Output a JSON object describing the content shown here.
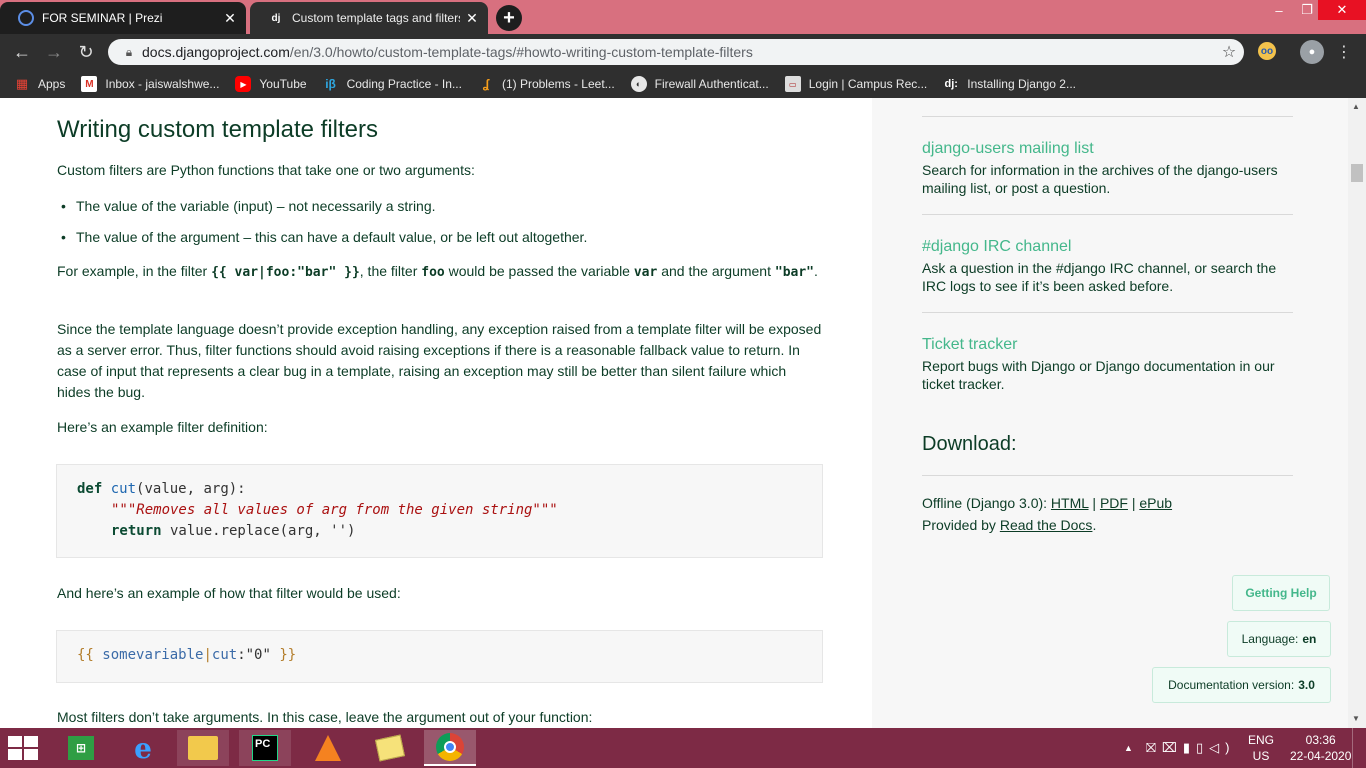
{
  "browser": {
    "tabs": [
      {
        "title": "FOR SEMINAR | Prezi",
        "favicon": "prezi-icon"
      },
      {
        "title": "Custom template tags and filters",
        "favicon": "django-icon"
      }
    ],
    "new_tab_label": "+",
    "address": {
      "host": "docs.djangoproject.com",
      "path": "/en/3.0/howto/custom-template-tags/#howto-writing-custom-template-filters"
    },
    "bookmarks": [
      {
        "label": "Apps",
        "icon": "apps-icon"
      },
      {
        "label": "Inbox - jaiswalshwe...",
        "icon": "gmail-icon"
      },
      {
        "label": "YouTube",
        "icon": "youtube-icon"
      },
      {
        "label": "Coding Practice - In...",
        "icon": "interviewbit-icon"
      },
      {
        "label": "(1) Problems - Leet...",
        "icon": "leetcode-icon"
      },
      {
        "label": "Firewall Authenticat...",
        "icon": "globe-icon"
      },
      {
        "label": "Login | Campus Rec...",
        "icon": "login-icon"
      },
      {
        "label": "Installing Django 2...",
        "icon": "django-icon"
      }
    ]
  },
  "article": {
    "heading": "Writing custom template filters",
    "intro": "Custom filters are Python functions that take one or two arguments:",
    "bullets": [
      "The value of the variable (input) – not necessarily a string.",
      "The value of the argument – this can have a default value, or be left out altogether."
    ],
    "example_parts": {
      "t1": "For example, in the filter ",
      "c1": "{{ var|foo:\"bar\" }}",
      "t2": ", the filter ",
      "c2": "foo",
      "t3": " would be passed the variable ",
      "c3": "var",
      "t4": " and the argument ",
      "c4": "\"bar\"",
      "t5": "."
    },
    "exceptions_para": "Since the template language doesn’t provide exception handling, any exception raised from a template filter will be exposed as a server error. Thus, filter functions should avoid raising exceptions if there is a reasonable fallback value to return. In case of input that represents a clear bug in a template, raising an exception may still be better than silent failure which hides the bug.",
    "example_def_label": "Here’s an example filter definition:",
    "code1": {
      "kw_def": "def",
      "fn_name": "cut",
      "signature": "(value, arg):",
      "docstring": "\"\"\"Removes all values of arg from the given string\"\"\"",
      "kw_return": "return",
      "return_expr": " value.replace(arg, '')"
    },
    "usage_label": "And here’s an example of how that filter would be used:",
    "code2": {
      "open": "{{",
      "var": "somevariable",
      "pipe": "|",
      "filter": "cut",
      "colon": ":",
      "arg": "\"0\"",
      "close": "}}"
    },
    "no_args_para": "Most filters don’t take arguments. In this case, leave the argument out of your function:"
  },
  "sidebar": {
    "resources": [
      {
        "title": "django-users mailing list",
        "desc": "Search for information in the archives of the django-users mailing list, or post a question."
      },
      {
        "title": "#django IRC channel",
        "desc": "Ask a question in the #django IRC channel, or search the IRC logs to see if it’s been asked before."
      },
      {
        "title": "Ticket tracker",
        "desc": "Report bugs with Django or Django documentation in our ticket tracker."
      }
    ],
    "download": {
      "heading": "Download:",
      "offline_label": "Offline (Django 3.0): ",
      "html": "HTML",
      "sep1": " | ",
      "pdf": "PDF",
      "sep2": " | ",
      "epub": "ePub",
      "provided_label": "Provided by ",
      "rtd": "Read the Docs",
      "period": "."
    },
    "getting_help": "Getting Help",
    "language_label": "Language:",
    "language_value": "en",
    "version_label": "Documentation version:",
    "version_value": "3.0"
  },
  "taskbar": {
    "lang_top": "ENG",
    "lang_bottom": "US",
    "time": "03:36",
    "date": "22-04-2020",
    "pycharm_label": "PC",
    "store_label": "⊞"
  },
  "colors": {
    "tab_strip": "#d8707f",
    "django_dark_green": "#0c3c26",
    "django_light_green": "#44b78b",
    "taskbar": "#7d2a45"
  }
}
